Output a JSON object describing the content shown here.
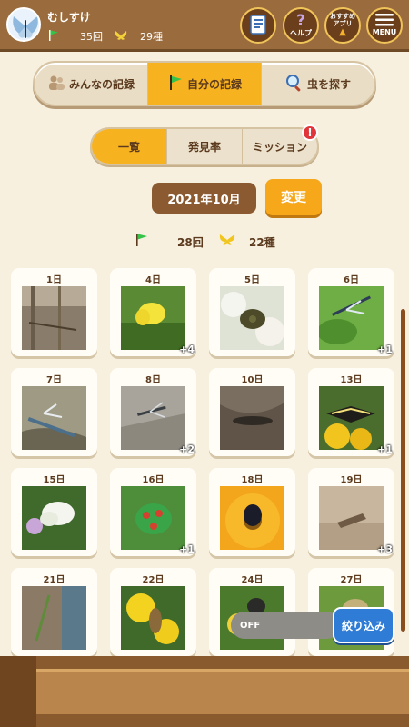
{
  "header": {
    "username": "むしすけ",
    "records": "35回",
    "species": "29種",
    "buttons": [
      {
        "label": "",
        "icon": "notebook-icon"
      },
      {
        "label": "ヘルプ",
        "icon": "help-icon"
      },
      {
        "label": "おすすめアプリ",
        "icon": "apps-icon"
      },
      {
        "label": "MENU",
        "icon": "menu-icon"
      }
    ]
  },
  "main_tabs": [
    {
      "label": "みんなの記録",
      "icon": "people-icon",
      "active": false
    },
    {
      "label": "自分の記録",
      "icon": "flag-icon",
      "active": true
    },
    {
      "label": "虫を探す",
      "icon": "magnifier-icon",
      "active": false
    }
  ],
  "sub_tabs": [
    {
      "label": "一覧",
      "active": true
    },
    {
      "label": "発見率",
      "active": false
    },
    {
      "label": "ミッション",
      "active": false
    }
  ],
  "mission_badge": "!",
  "month": "2021年10月",
  "change_label": "変更",
  "summary": {
    "records": "28回",
    "species": "22種"
  },
  "days": [
    {
      "day": "1日",
      "more": ""
    },
    {
      "day": "4日",
      "more": "+4"
    },
    {
      "day": "5日",
      "more": ""
    },
    {
      "day": "6日",
      "more": "+1"
    },
    {
      "day": "7日",
      "more": ""
    },
    {
      "day": "8日",
      "more": "+2"
    },
    {
      "day": "10日",
      "more": ""
    },
    {
      "day": "13日",
      "more": "+1"
    },
    {
      "day": "15日",
      "more": ""
    },
    {
      "day": "16日",
      "more": "+1"
    },
    {
      "day": "18日",
      "more": ""
    },
    {
      "day": "19日",
      "more": "+3"
    },
    {
      "day": "21日",
      "more": ""
    },
    {
      "day": "22日",
      "more": ""
    },
    {
      "day": "24日",
      "more": ""
    },
    {
      "day": "27日",
      "more": ""
    }
  ],
  "filter": {
    "state": "OFF",
    "label": "絞り込み"
  },
  "colors": {
    "accent": "#f7b21f",
    "header": "#9a6b3c",
    "filter_button": "#2f7cd6"
  }
}
